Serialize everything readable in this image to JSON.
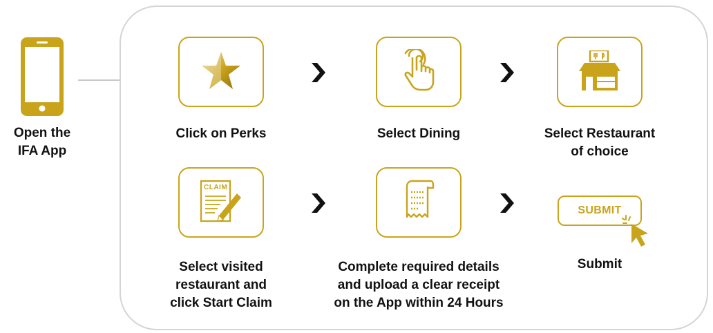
{
  "colors": {
    "accent": "#c9a41b",
    "frame": "#d4d4d4",
    "text": "#111111"
  },
  "start": {
    "icon": "smartphone-icon",
    "label": "Open the\nIFA App"
  },
  "steps": [
    {
      "icon": "star-icon",
      "label": "Click on Perks"
    },
    {
      "icon": "touch-hand-icon",
      "label": "Select Dining"
    },
    {
      "icon": "restaurant-icon",
      "label": "Select Restaurant\nof choice"
    },
    {
      "icon": "claim-form-icon",
      "icon_text": "CLAIM",
      "label": "Select visited\nrestaurant and\nclick Start Claim"
    },
    {
      "icon": "receipt-icon",
      "label": "Complete required details\nand upload a clear receipt\non the App within 24 Hours"
    },
    {
      "icon": "cursor-icon",
      "button_text": "SUBMIT",
      "label": "Submit"
    }
  ],
  "arrow_icon": "chevron-right-icon"
}
